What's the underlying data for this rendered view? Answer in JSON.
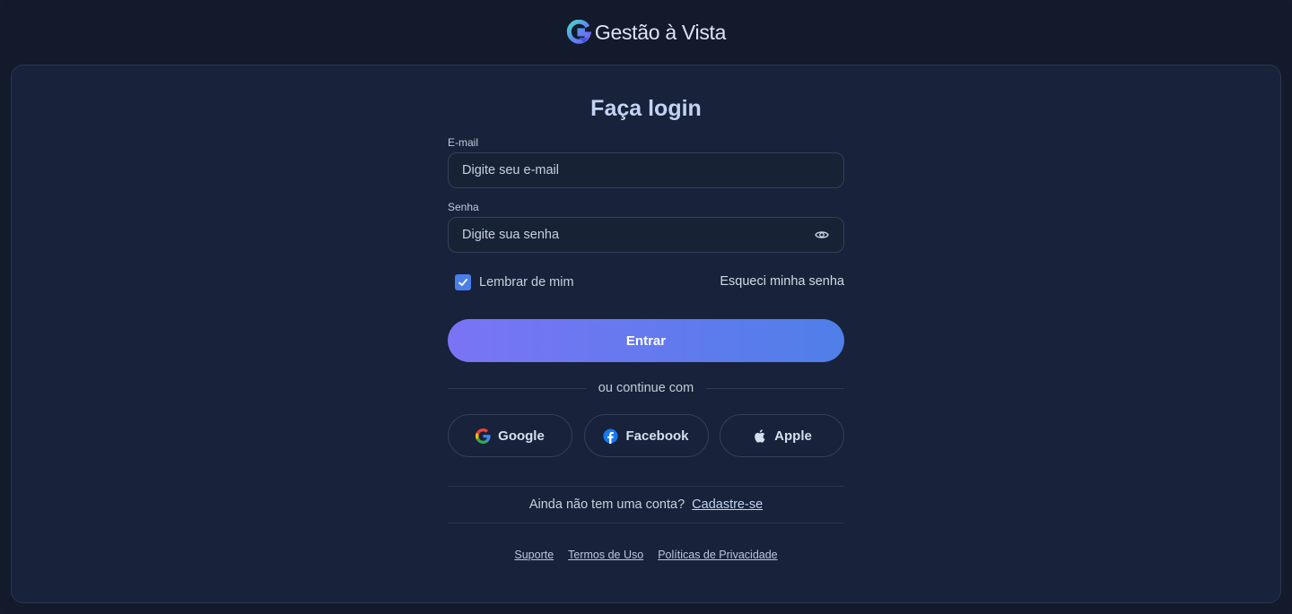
{
  "brand": {
    "name": "Gestão à Vista",
    "logo_icon": "g-logo-icon"
  },
  "login": {
    "title": "Faça login",
    "email": {
      "label": "E-mail",
      "placeholder": "Digite seu e-mail",
      "value": ""
    },
    "password": {
      "label": "Senha",
      "placeholder": "Digite sua senha",
      "value": "",
      "toggle_icon": "eye-icon"
    },
    "remember": {
      "label": "Lembrar de mim",
      "checked": true
    },
    "forgot_label": "Esqueci minha senha",
    "submit_label": "Entrar",
    "divider_text": "ou continue com",
    "social": [
      {
        "label": "Google",
        "icon": "google-icon"
      },
      {
        "label": "Facebook",
        "icon": "facebook-icon"
      },
      {
        "label": "Apple",
        "icon": "apple-icon"
      }
    ],
    "signup_prompt": "Ainda não tem uma conta?",
    "signup_link": "Cadastre-se"
  },
  "footer": {
    "links": [
      "Suporte",
      "Termos de Uso",
      "Políticas de Privacidade"
    ]
  },
  "colors": {
    "background": "#121a2b",
    "panel": "#18223a",
    "accent_start": "#7a74f5",
    "accent_end": "#4f7fe8",
    "checkbox": "#4a7ee8"
  }
}
